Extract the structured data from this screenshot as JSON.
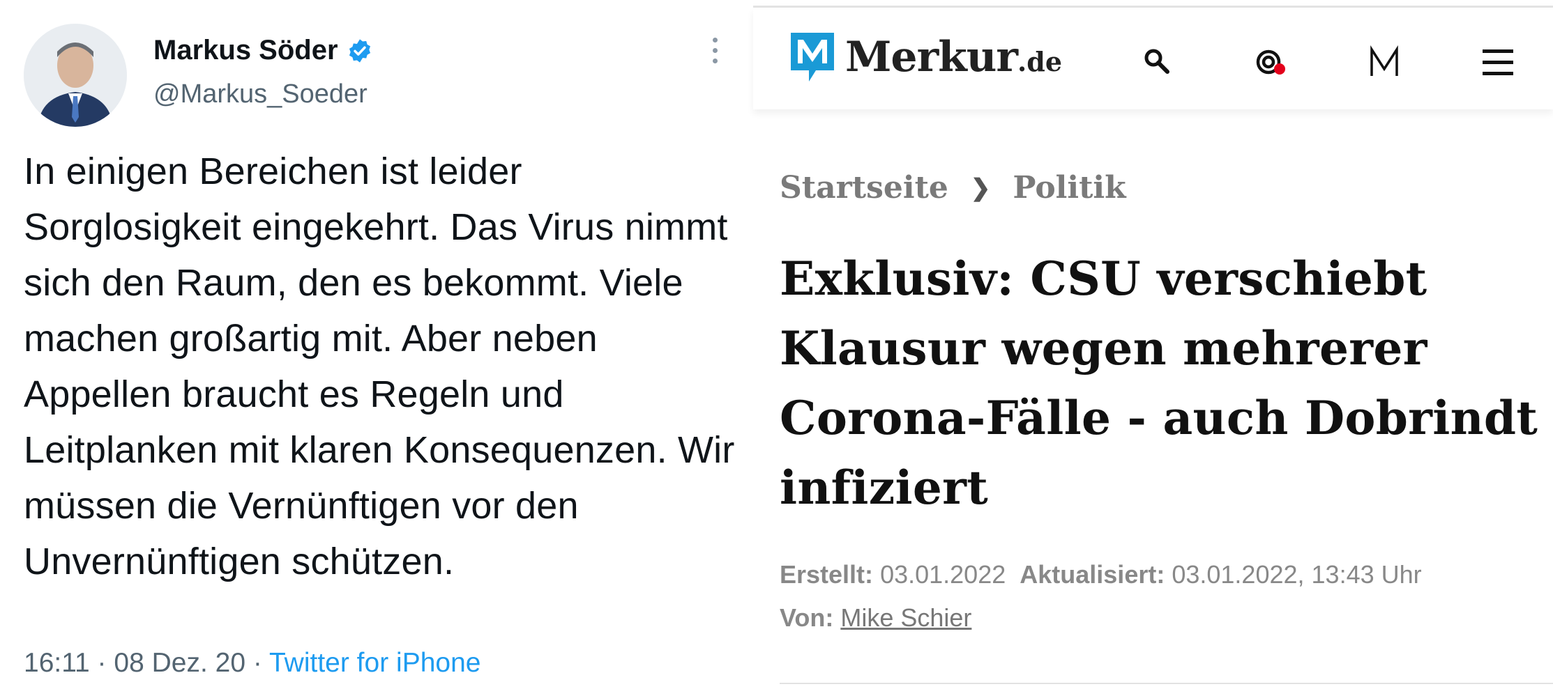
{
  "tweet": {
    "user_name": "Markus Söder",
    "handle": "@Markus_Soeder",
    "text": "In einigen Bereichen ist leider Sorglosigkeit eingekehrt. Das Virus nimmt sich den Raum, den es bekommt. Viele machen großartig mit. Aber neben Appellen braucht es Regeln und Leitplanken mit klaren Konsequenzen. Wir müssen die Vernünftigen vor den Unvernünftigen schützen.",
    "time": "16:11",
    "date": "08 Dez. 20",
    "separator": "·",
    "source": "Twitter for iPhone",
    "verified_icon": "verified-badge-icon",
    "more_icon": "more-options-icon",
    "colors": {
      "verified": "#1d9bf0",
      "link": "#1d9bf0",
      "secondary_text": "#536471"
    }
  },
  "merkur": {
    "logo_name": "Merkur",
    "logo_tld": ".de",
    "header_icons": [
      "search-icon",
      "live-icon",
      "m-icon",
      "menu-icon"
    ],
    "breadcrumb": {
      "home": "Startseite",
      "separator": "❯",
      "section": "Politik"
    },
    "headline": "Exklusiv: CSU verschiebt Klausur wegen mehrerer Corona-Fälle - auch Dobrindt infiziert",
    "created_label": "Erstellt:",
    "created_value": "03.01.2022",
    "updated_label": "Aktualisiert:",
    "updated_value": "03.01.2022, 13:43 Uhr",
    "author_label": "Von:",
    "author_name": "Mike Schier",
    "colors": {
      "logo_blue": "#1a9ad6",
      "live_dot": "#e3001b",
      "headline": "#111111"
    }
  }
}
